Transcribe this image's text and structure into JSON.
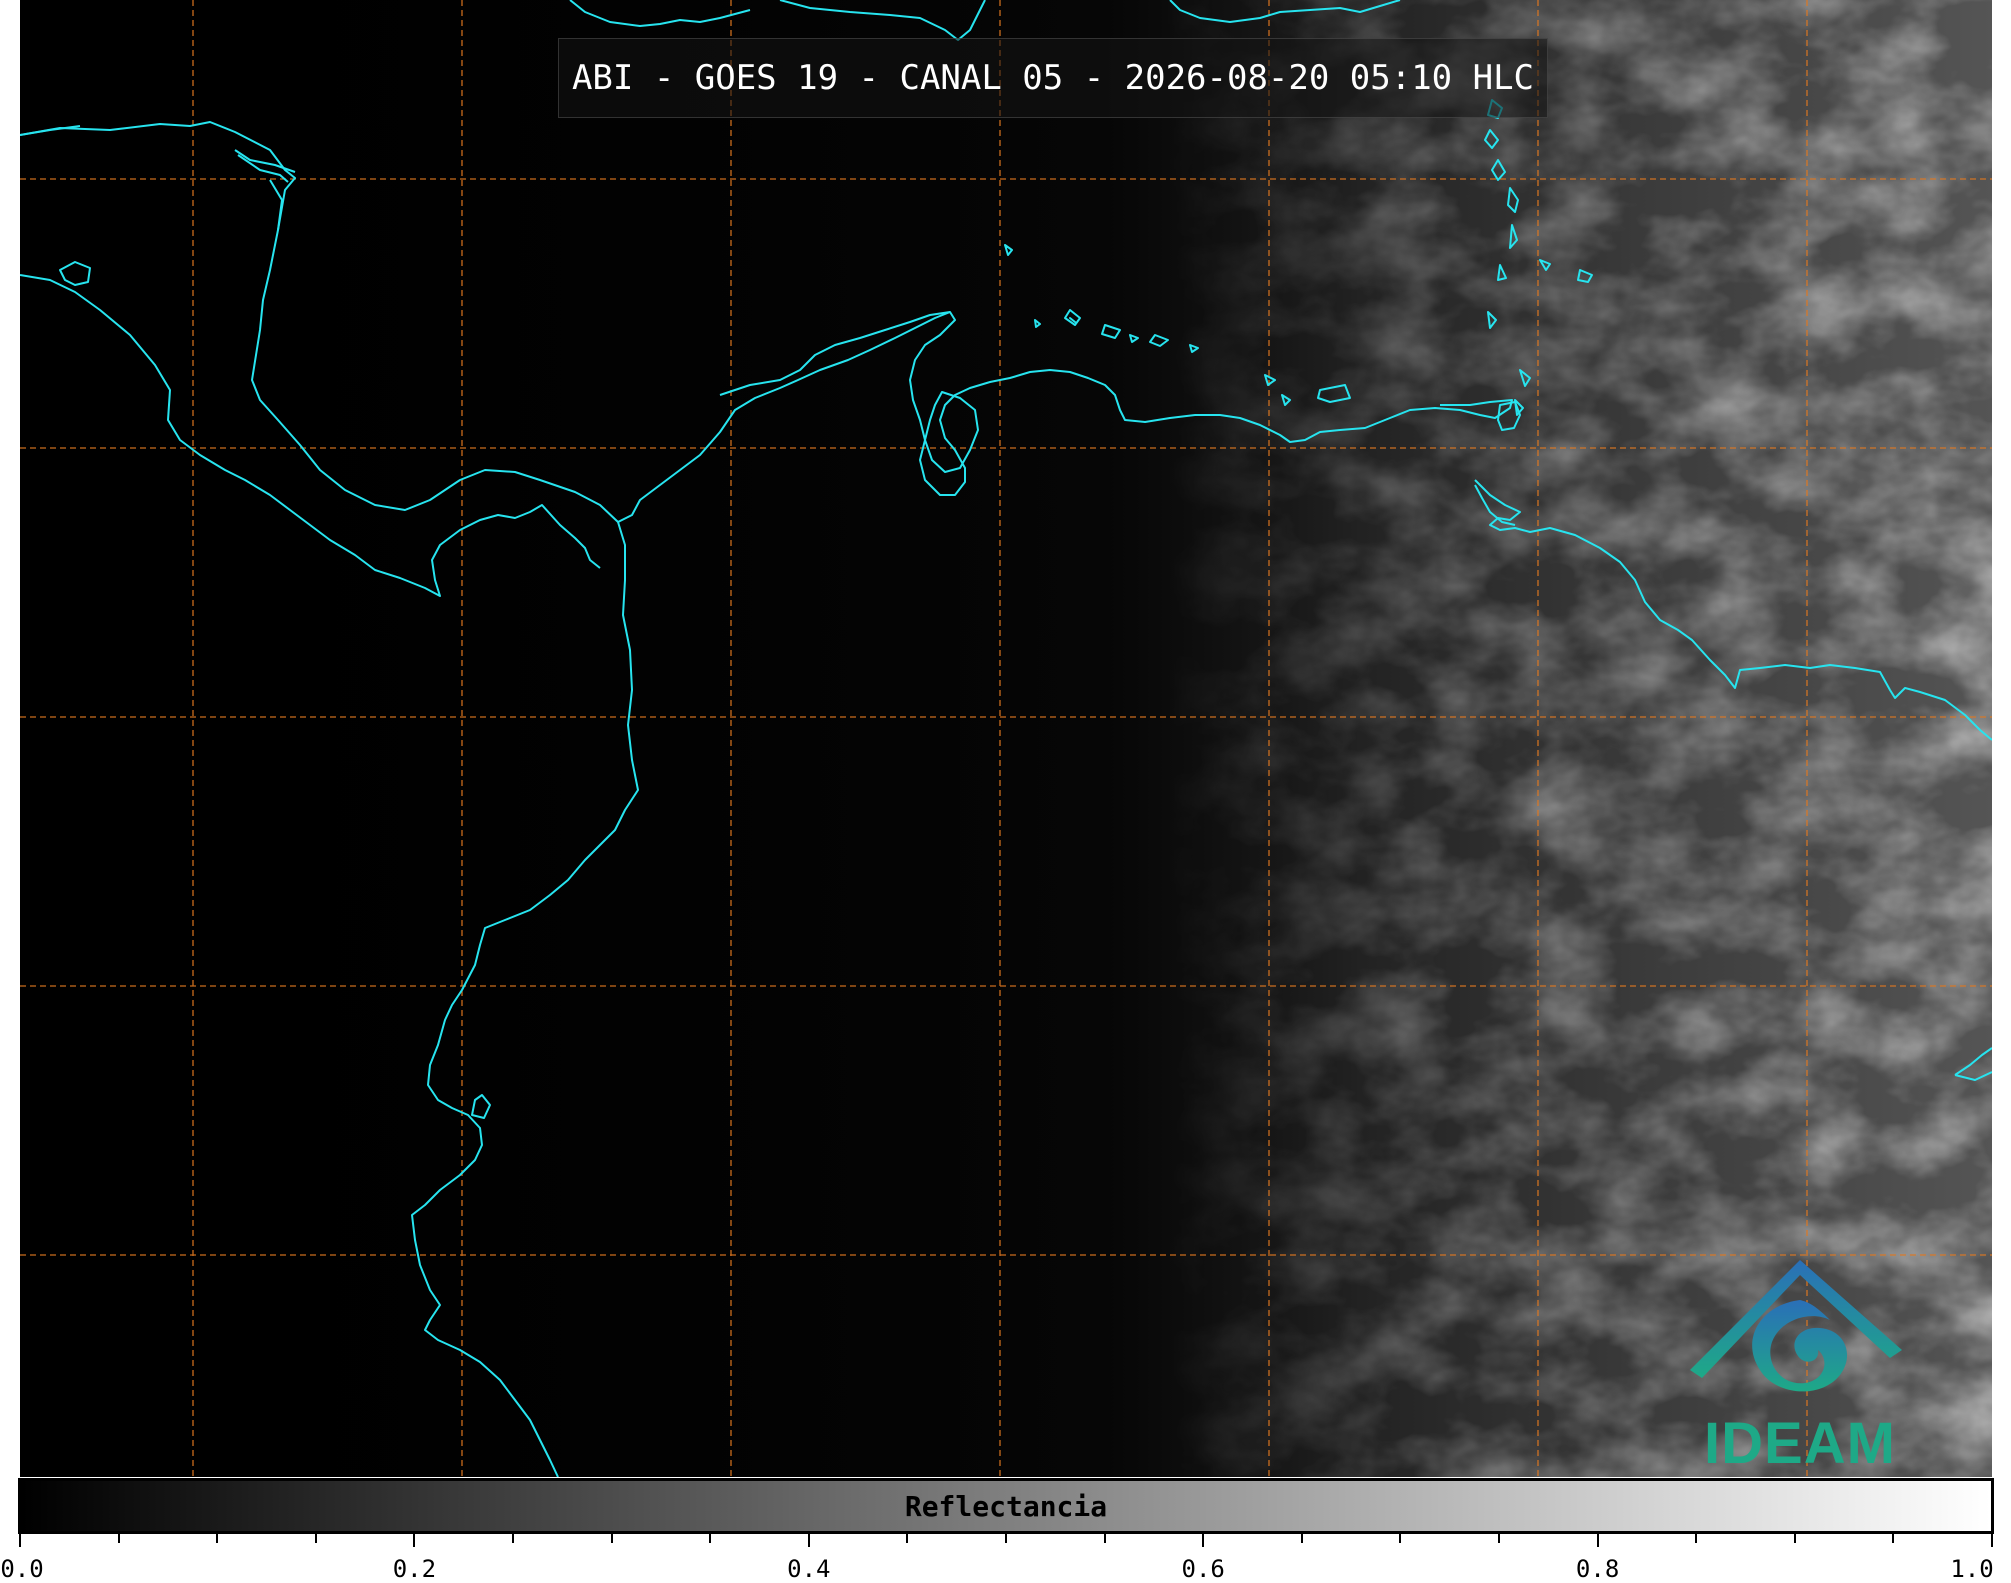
{
  "title": "ABI - GOES 19 - CANAL 05 - 2026-08-20 05:10 HLC",
  "logo": {
    "text": "IDEAM",
    "icon": "ideam-logo-icon"
  },
  "colorbar": {
    "label": "Reflectancia",
    "min": 0.0,
    "max": 1.0,
    "tick_labels": [
      "0.0",
      "0.2",
      "0.4",
      "0.6",
      "0.8",
      "1.0"
    ],
    "colors": {
      "low": "#000000",
      "high": "#ffffff"
    }
  },
  "map": {
    "coastline_color": "#27e4ef",
    "gridline_color": "#e07820",
    "background_color": "#000000"
  }
}
